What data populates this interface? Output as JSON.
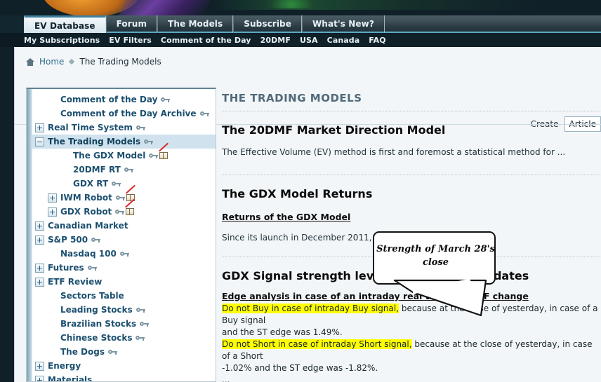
{
  "window": {
    "banner_alt": "site-banner-artwork"
  },
  "tabs": [
    {
      "label": "EV Database",
      "active": true
    },
    {
      "label": "Forum",
      "active": false
    },
    {
      "label": "The Models",
      "active": false
    },
    {
      "label": "Subscribe",
      "active": false
    },
    {
      "label": "What's New?",
      "active": false
    }
  ],
  "subnav": [
    {
      "label": "My Subscriptions"
    },
    {
      "label": "EV Filters"
    },
    {
      "label": "Comment of the Day"
    },
    {
      "label": "20DMF"
    },
    {
      "label": "USA"
    },
    {
      "label": "Canada"
    },
    {
      "label": "FAQ"
    }
  ],
  "breadcrumb": {
    "home": "Home",
    "current": "The Trading Models"
  },
  "create": {
    "label": "Create",
    "selected": "Article"
  },
  "sidebar": {
    "items": [
      {
        "label": "Comment of the Day",
        "indent": 1,
        "expander": "none",
        "key": true,
        "book": false,
        "selected": false
      },
      {
        "label": "Comment of the Day Archive",
        "indent": 1,
        "expander": "none",
        "key": true,
        "book": false,
        "selected": false
      },
      {
        "label": "Real Time System",
        "indent": 0,
        "expander": "plus",
        "key": true,
        "book": false,
        "selected": false
      },
      {
        "label": "The Trading Models",
        "indent": 0,
        "expander": "minus",
        "key": true,
        "book": false,
        "selected": true
      },
      {
        "label": "The GDX Model",
        "indent": 2,
        "expander": "none",
        "key": true,
        "book": true,
        "selected": false
      },
      {
        "label": "20DMF RT",
        "indent": 2,
        "expander": "none",
        "key": true,
        "book": false,
        "selected": false
      },
      {
        "label": "GDX RT",
        "indent": 2,
        "expander": "none",
        "key": true,
        "book": false,
        "selected": false
      },
      {
        "label": "IWM Robot",
        "indent": 1,
        "expander": "plus",
        "key": true,
        "book": true,
        "selected": false
      },
      {
        "label": "GDX Robot",
        "indent": 1,
        "expander": "plus",
        "key": true,
        "book": true,
        "selected": false
      },
      {
        "label": "Canadian Market",
        "indent": 0,
        "expander": "plus",
        "key": false,
        "book": false,
        "selected": false
      },
      {
        "label": "S&P 500",
        "indent": 0,
        "expander": "plus",
        "key": true,
        "book": false,
        "selected": false
      },
      {
        "label": "Nasdaq 100",
        "indent": 1,
        "expander": "none",
        "key": true,
        "book": false,
        "selected": false
      },
      {
        "label": "Futures",
        "indent": 0,
        "expander": "plus",
        "key": true,
        "book": false,
        "selected": false
      },
      {
        "label": "ETF Review",
        "indent": 0,
        "expander": "plus",
        "key": false,
        "book": false,
        "selected": false
      },
      {
        "label": "Sectors Table",
        "indent": 1,
        "expander": "none",
        "key": false,
        "book": false,
        "selected": false
      },
      {
        "label": "Leading Stocks",
        "indent": 1,
        "expander": "none",
        "key": true,
        "book": false,
        "selected": false
      },
      {
        "label": "Brazilian Stocks",
        "indent": 1,
        "expander": "none",
        "key": true,
        "book": false,
        "selected": false
      },
      {
        "label": "Chinese Stocks",
        "indent": 1,
        "expander": "none",
        "key": true,
        "book": false,
        "selected": false
      },
      {
        "label": "The Dogs",
        "indent": 1,
        "expander": "none",
        "key": true,
        "book": false,
        "selected": false
      },
      {
        "label": "Energy",
        "indent": 0,
        "expander": "plus",
        "key": false,
        "book": false,
        "selected": false
      },
      {
        "label": "Materials",
        "indent": 0,
        "expander": "plus",
        "key": false,
        "book": false,
        "selected": false
      }
    ]
  },
  "content": {
    "page_title": "THE TRADING MODELS",
    "section1": {
      "heading": "The 20DMF Market Direction Model",
      "text": "The Effective Volume (EV) method is first and foremost a statistical method for ..."
    },
    "section2": {
      "heading": "The GDX Model Returns",
      "subheading": "Returns of the GDX Model",
      "text": "Since its launch in December 2011, as o"
    },
    "section3": {
      "heading": "GDX Signal strength level and real time updates",
      "subheading": "Edge analysis in case of an intraday real time GDX MF change",
      "line1_highlight": "Do not Buy in case of intraday Buy signal,",
      "line1_rest": " because at the close of yesterday, in case of a Buy signal",
      "line1_cont": "and the ST edge was 1.49%.",
      "line2_highlight": "Do not Short in case of intraday Short signal,",
      "line2_rest": " because at the close of yesterday, in case of a Short",
      "line2_cont": "-1.02% and the ST edge was -1.82%.",
      "ellipsis": "..."
    }
  },
  "callout": {
    "text": "Strength of March 28's close"
  },
  "colors": {
    "header_dark": "#102028",
    "tab_accent": "#5fa8c4",
    "page_bg": "#f2f6f8",
    "tree_selected": "#cfe2ee",
    "link_blue": "#1c5070",
    "highlight_yellow": "#ffff00"
  }
}
